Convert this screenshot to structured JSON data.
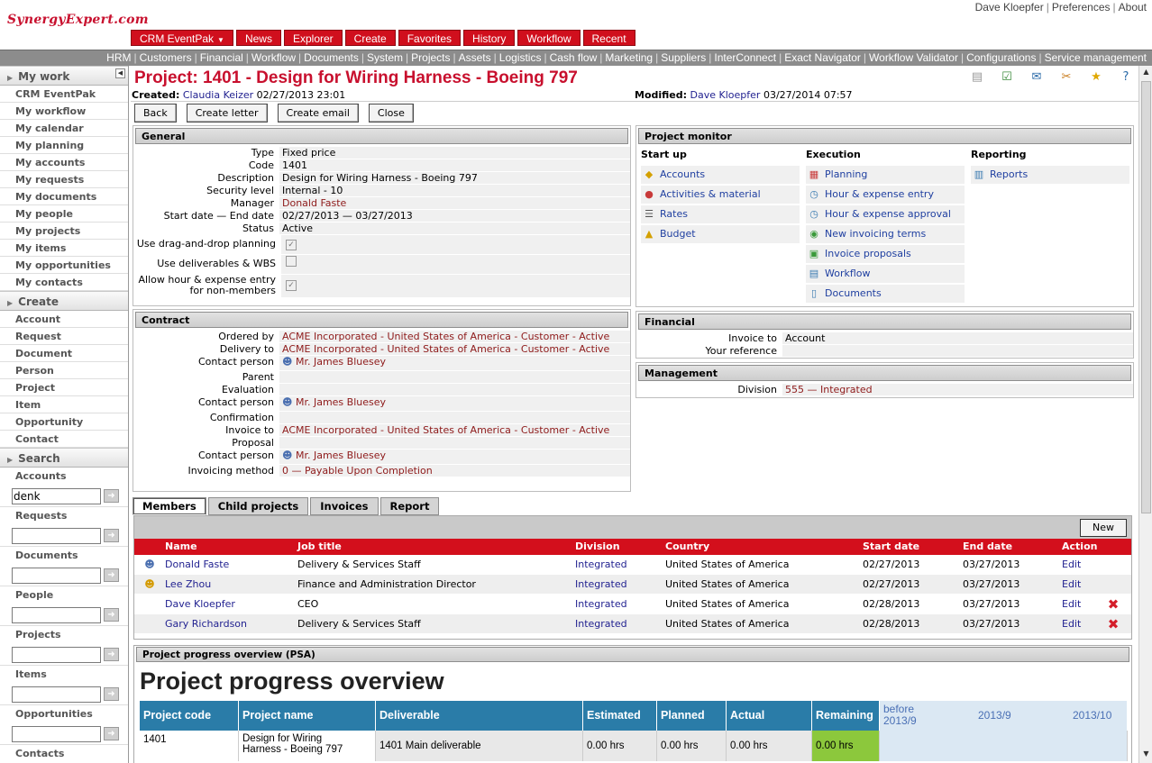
{
  "header": {
    "logo": "SynergyExpert.com",
    "user": "Dave Kloepfer",
    "preferences": "Preferences",
    "about": "About",
    "menu": [
      "CRM EventPak",
      "News",
      "Explorer",
      "Create",
      "Favorites",
      "History",
      "Workflow",
      "Recent"
    ],
    "submenu": [
      "HRM",
      "Customers",
      "Financial",
      "Workflow",
      "Documents",
      "System",
      "Projects",
      "Assets",
      "Logistics",
      "Cash flow",
      "Marketing",
      "Suppliers",
      "InterConnect",
      "Exact Navigator",
      "Workflow Validator",
      "Configurations",
      "Service management"
    ]
  },
  "sidebar": {
    "mywork_title": "My work",
    "mywork": [
      "CRM EventPak",
      "My workflow",
      "My calendar",
      "My planning",
      "My accounts",
      "My requests",
      "My documents",
      "My people",
      "My projects",
      "My items",
      "My opportunities",
      "My contacts"
    ],
    "create_title": "Create",
    "create": [
      "Account",
      "Request",
      "Document",
      "Person",
      "Project",
      "Item",
      "Opportunity",
      "Contact"
    ],
    "search_title": "Search",
    "search_fields": [
      {
        "label": "Accounts",
        "value": "denk"
      },
      {
        "label": "Requests",
        "value": ""
      },
      {
        "label": "Documents",
        "value": ""
      },
      {
        "label": "People",
        "value": ""
      },
      {
        "label": "Projects",
        "value": ""
      },
      {
        "label": "Items",
        "value": ""
      },
      {
        "label": "Opportunities",
        "value": ""
      },
      {
        "label": "Contacts",
        "value": ""
      }
    ]
  },
  "page": {
    "title": "Project: 1401 - Design for Wiring Harness - Boeing 797",
    "created_label": "Created:",
    "created_by": "Claudia Keizer",
    "created_date": "02/27/2013 23:01",
    "modified_label": "Modified:",
    "modified_by": "Dave Kloepfer",
    "modified_date": "03/27/2014 07:57",
    "buttons": [
      "Back",
      "Create letter",
      "Create email",
      "Close"
    ]
  },
  "general": {
    "title": "General",
    "type_label": "Type",
    "type": "Fixed price",
    "code_label": "Code",
    "code": "1401",
    "description_label": "Description",
    "description": "Design for Wiring Harness - Boeing 797",
    "security_label": "Security level",
    "security": "Internal - 10",
    "manager_label": "Manager",
    "manager": "Donald Faste",
    "dates_label": "Start date — End date",
    "dates": "02/27/2013 — 03/27/2013",
    "status_label": "Status",
    "status": "Active",
    "dnd_label": "Use drag-and-drop planning",
    "deliverables_label": "Use deliverables & WBS",
    "allow_label_1": "Allow hour & expense entry",
    "allow_label_2": "for non-members"
  },
  "contract": {
    "title": "Contract",
    "ordered_label": "Ordered by",
    "ordered": "ACME Incorporated - United States of America - Customer - Active",
    "delivery_label": "Delivery to",
    "delivery": "ACME Incorporated - United States of America - Customer - Active",
    "contact_label": "Contact person",
    "contact": "Mr. James Bluesey",
    "parent_label": "Parent",
    "evaluation_label": "Evaluation",
    "confirmation_label": "Confirmation",
    "invoice_label": "Invoice to",
    "invoice": "ACME Incorporated - United States of America - Customer - Active",
    "proposal_label": "Proposal",
    "method_label": "Invoicing method",
    "method": "0 — Payable Upon Completion"
  },
  "monitor": {
    "title": "Project monitor",
    "startup_title": "Start up",
    "startup": [
      "Accounts",
      "Activities & material",
      "Rates",
      "Budget"
    ],
    "execution_title": "Execution",
    "execution": [
      "Planning",
      "Hour & expense entry",
      "Hour & expense approval",
      "New invoicing terms",
      "Invoice proposals",
      "Workflow",
      "Documents"
    ],
    "reporting_title": "Reporting",
    "reporting": [
      "Reports"
    ]
  },
  "financial": {
    "title": "Financial",
    "invoice_label": "Invoice to",
    "invoice": "Account",
    "ref_label": "Your reference",
    "ref": ""
  },
  "management": {
    "title": "Management",
    "division_label": "Division",
    "division": "555 — Integrated"
  },
  "tabs": [
    "Members",
    "Child projects",
    "Invoices",
    "Report"
  ],
  "members": {
    "new_label": "New",
    "headers": [
      "Name",
      "Job title",
      "Division",
      "Country",
      "Start date",
      "End date",
      "Action"
    ],
    "rows": [
      {
        "name": "Donald Faste",
        "job": "Delivery & Services Staff",
        "division": "Integrated",
        "country": "United States of America",
        "start": "02/27/2013",
        "end": "03/27/2013",
        "action": "Edit"
      },
      {
        "name": "Lee Zhou",
        "job": "Finance and Administration Director",
        "division": "Integrated",
        "country": "United States of America",
        "start": "02/27/2013",
        "end": "03/27/2013",
        "action": "Edit"
      },
      {
        "name": "Dave Kloepfer",
        "job": "CEO",
        "division": "Integrated",
        "country": "United States of America",
        "start": "02/28/2013",
        "end": "03/27/2013",
        "action": "Edit"
      },
      {
        "name": "Gary Richardson",
        "job": "Delivery & Services Staff",
        "division": "Integrated",
        "country": "United States of America",
        "start": "02/28/2013",
        "end": "03/27/2013",
        "action": "Edit"
      }
    ]
  },
  "psa": {
    "header": "Project progress overview (PSA)",
    "title": "Project progress overview",
    "columns": [
      "Project code",
      "Project name",
      "Deliverable",
      "Estimated",
      "Planned",
      "Actual",
      "Remaining"
    ],
    "period_before_1": "before",
    "period_before_2": "2013/9",
    "period_1": "2013/9",
    "period_2": "2013/10",
    "row": {
      "code": "1401",
      "name_1": "Design for Wiring",
      "name_2": "Harness - Boeing 797",
      "deliverable": "1401 Main deliverable",
      "estimated": "0.00 hrs",
      "planned": "0.00 hrs",
      "actual": "0.00 hrs",
      "remaining": "0.00 hrs"
    }
  }
}
